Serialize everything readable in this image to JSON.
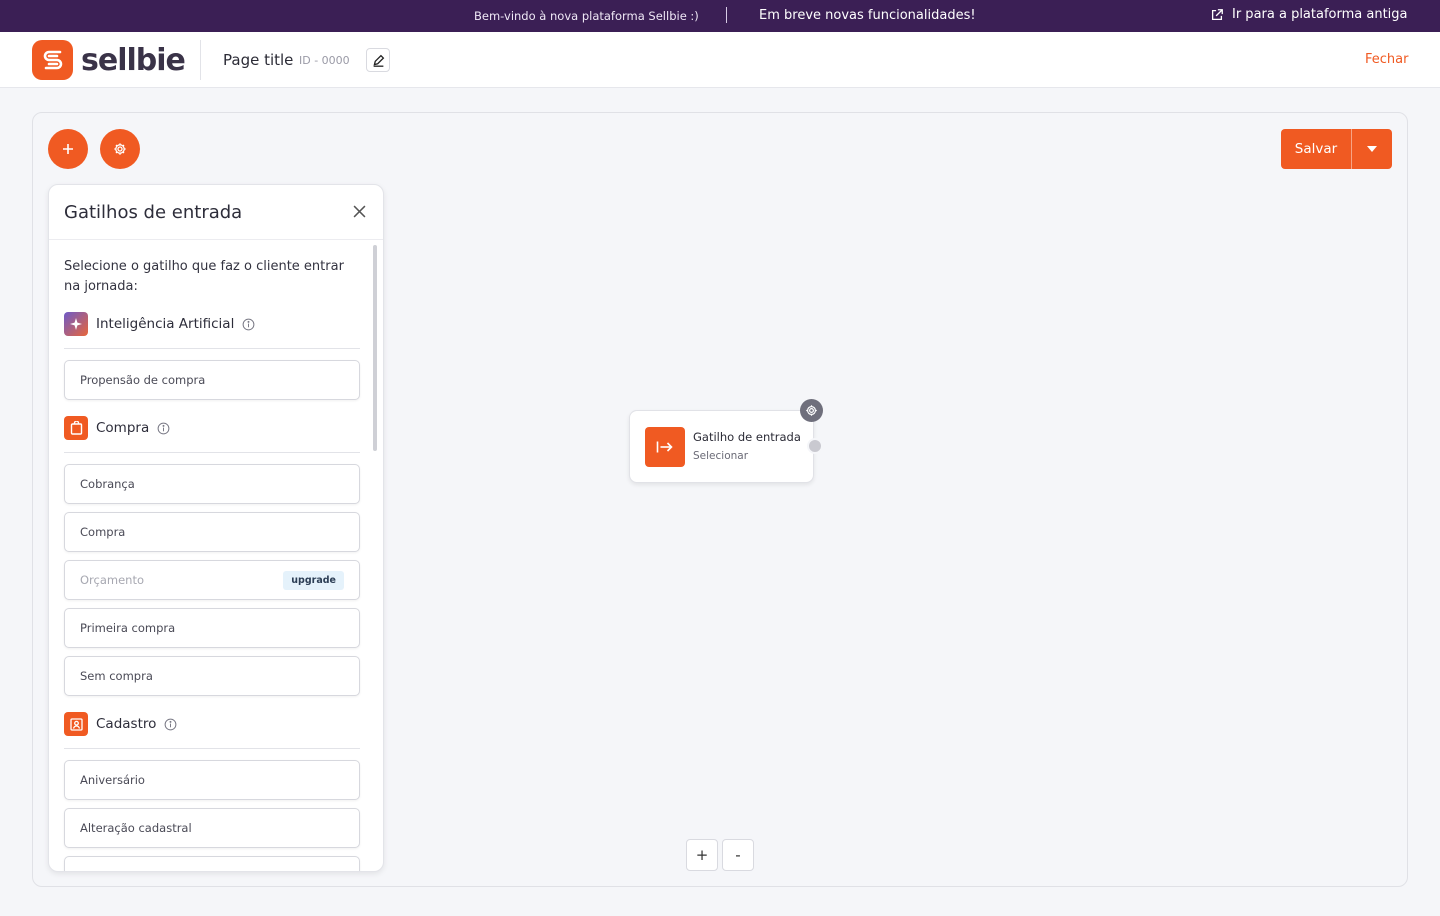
{
  "banner": {
    "welcome": "Bem-vindo à nova plataforma Sellbie :)",
    "soon": "Em breve novas funcionalidades!",
    "old_platform": "Ir para a plataforma antiga",
    "background": "#3b1f55"
  },
  "header": {
    "logo_text": "sellbie",
    "page_title": "Page title",
    "page_id": "ID - 0000",
    "close": "Fechar",
    "accent": "#f05a22"
  },
  "toolbar": {
    "add": "+",
    "save": "Salvar"
  },
  "panel": {
    "title": "Gatilhos de entrada",
    "intro": "Selecione o gatilho que faz o cliente entrar na jornada:",
    "sections": [
      {
        "label": "Inteligência Artificial",
        "icon": "sparkle-icon",
        "options": [
          "Propensão de compra"
        ]
      },
      {
        "label": "Compra",
        "icon": "shopping-bag-icon",
        "options": [
          "Cobrança",
          "Compra",
          "Orçamento",
          "Primeira compra",
          "Sem compra"
        ],
        "disabled_option": "Orçamento",
        "disabled_tag": "upgrade"
      },
      {
        "label": "Cadastro",
        "icon": "contact-card-icon",
        "options": [
          "Aniversário",
          "Alteração cadastral"
        ]
      }
    ]
  },
  "node": {
    "title": "Gatilho de entrada",
    "subtitle": "Selecionar",
    "icon": "entry-arrow-icon"
  },
  "zoom": {
    "in": "+",
    "out": "-"
  }
}
